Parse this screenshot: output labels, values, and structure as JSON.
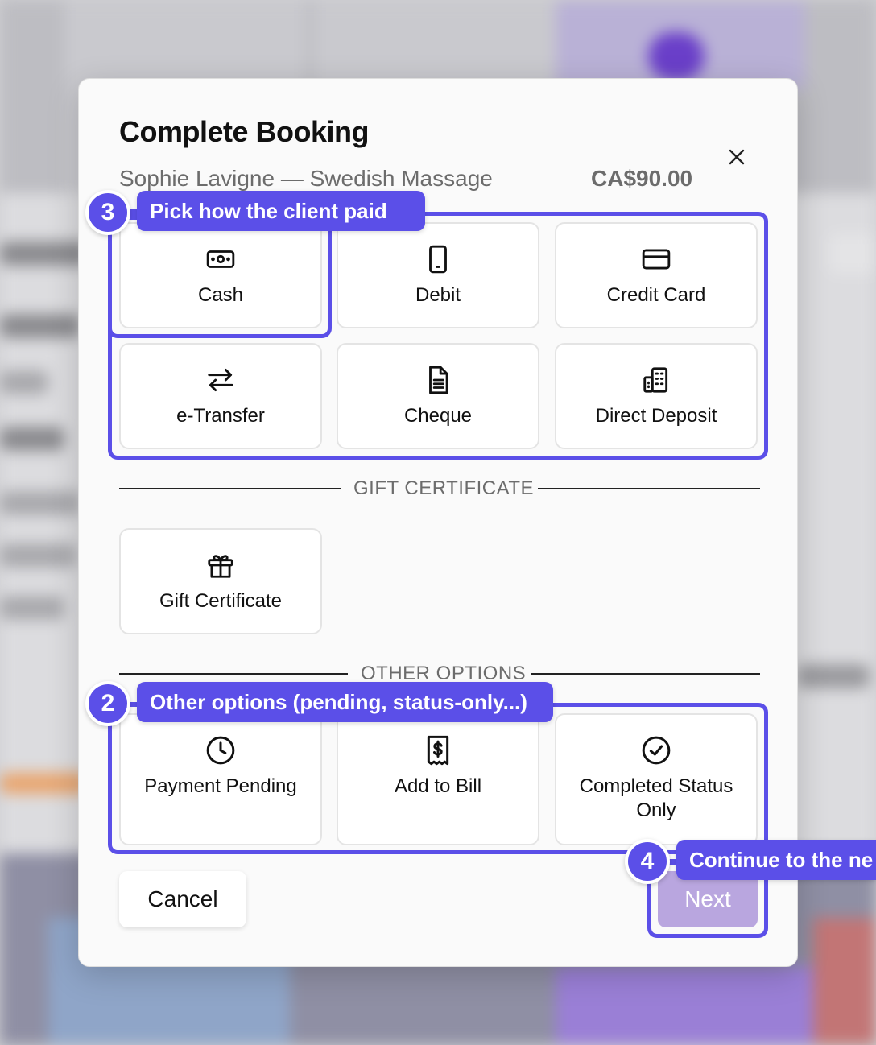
{
  "modal": {
    "title": "Complete Booking",
    "subtitle": "Sophie Lavigne — Swedish Massage",
    "price": "CA$90.00"
  },
  "payment_methods": [
    {
      "label": "Cash",
      "icon": "cash-icon"
    },
    {
      "label": "Debit",
      "icon": "debit-card-icon"
    },
    {
      "label": "Credit Card",
      "icon": "credit-card-icon"
    },
    {
      "label": "e-Transfer",
      "icon": "transfer-arrows-icon"
    },
    {
      "label": "Cheque",
      "icon": "document-icon"
    },
    {
      "label": "Direct Deposit",
      "icon": "bank-building-icon"
    }
  ],
  "gift_section": {
    "heading": "GIFT CERTIFICATE",
    "option": {
      "label": "Gift Certificate",
      "icon": "gift-icon"
    }
  },
  "other_section": {
    "heading": "OTHER OPTIONS",
    "options": [
      {
        "label": "Payment Pending",
        "icon": "clock-icon"
      },
      {
        "label": "Add to Bill",
        "icon": "receipt-dollar-icon"
      },
      {
        "label": "Completed Status\nOnly",
        "icon": "check-circle-icon"
      }
    ]
  },
  "footer": {
    "cancel_label": "Cancel",
    "next_label": "Next"
  },
  "tutorial": {
    "step3": {
      "number": "3",
      "text": "Pick how the client paid"
    },
    "step2": {
      "number": "2",
      "text": "Other options (pending, status-only...)"
    },
    "step4": {
      "number": "4",
      "text": "Continue to the ne"
    }
  },
  "colors": {
    "accent": "#5b4fe8",
    "next_button": "#b9a6df",
    "muted_text": "#6c6c6c"
  }
}
